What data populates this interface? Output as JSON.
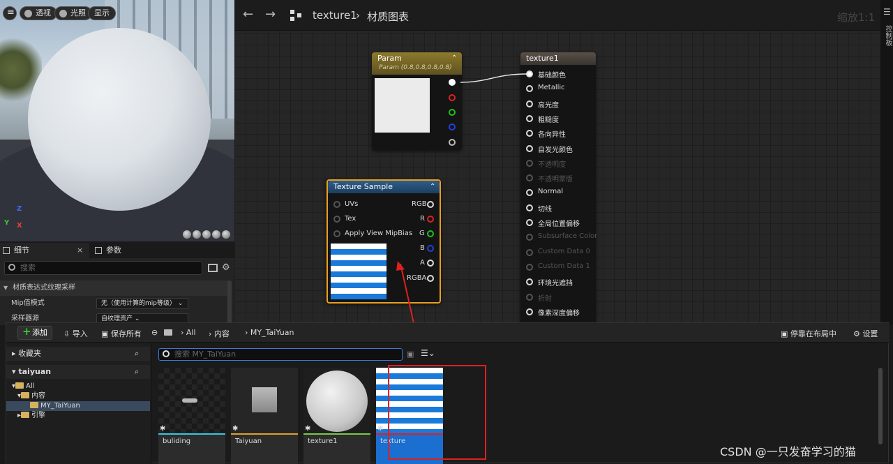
{
  "viewport": {
    "buttons": [
      "透视",
      "光照",
      "显示"
    ],
    "axes": {
      "z": "Z",
      "y": "Y",
      "x": "X"
    }
  },
  "details": {
    "tab_details": "细节",
    "tab_params": "参数",
    "search_placeholder": "搜索",
    "section": "材质表达式纹理采样",
    "rows": [
      {
        "label": "Mip值模式",
        "value": "无（使用计算的mip等级）"
      },
      {
        "label": "采样器源",
        "value": "自纹理资产"
      }
    ]
  },
  "graph": {
    "breadcrumb_asset": "texture1",
    "breadcrumb_sep": "›",
    "breadcrumb_graph": "材质图表",
    "zoom": "缩放1:1",
    "side_panel": "控制板",
    "param_node": {
      "title": "Param",
      "subtitle": "Param (0.8,0.8,0.8,0.8)"
    },
    "texture_node": {
      "title": "Texture Sample",
      "inputs": [
        "UVs",
        "Tex",
        "Apply View MipBias"
      ],
      "outputs": [
        "RGB",
        "R",
        "G",
        "B",
        "A",
        "RGBA"
      ]
    },
    "result_node": {
      "title": "texture1",
      "pins": [
        {
          "label": "基础颜色",
          "active": true,
          "connected": true
        },
        {
          "label": "Metallic",
          "active": true
        },
        {
          "label": "高光度",
          "active": true
        },
        {
          "label": "粗糙度",
          "active": true
        },
        {
          "label": "各向异性",
          "active": true
        },
        {
          "label": "自发光颜色",
          "active": true
        },
        {
          "label": "不透明度",
          "active": false
        },
        {
          "label": "不透明蒙版",
          "active": false
        },
        {
          "label": "Normal",
          "active": true
        },
        {
          "label": "切线",
          "active": true
        },
        {
          "label": "全局位置偏移",
          "active": true
        },
        {
          "label": "Subsurface Color",
          "active": false
        },
        {
          "label": "Custom Data 0",
          "active": false
        },
        {
          "label": "Custom Data 1",
          "active": false
        },
        {
          "label": "环境光遮挡",
          "active": true
        },
        {
          "label": "折射",
          "active": false
        },
        {
          "label": "像素深度偏移",
          "active": true
        }
      ]
    }
  },
  "content_browser": {
    "add": "添加",
    "import": "导入",
    "save_all": "保存所有",
    "path": [
      "All",
      "内容",
      "MY_TaiYuan"
    ],
    "dock": "停靠在布局中",
    "settings": "设置",
    "favorites": "收藏夹",
    "project": "taiyuan",
    "tree": [
      "All",
      "内容",
      "MY_TaiYuan",
      "引擎"
    ],
    "search_placeholder": "搜索 MY_TaiYuan",
    "assets": [
      {
        "name": "buliding",
        "color": "#38c6e0"
      },
      {
        "name": "Taiyuan",
        "color": "#e0a030"
      },
      {
        "name": "texture1",
        "color": "#7ac943"
      },
      {
        "name": "texture",
        "color": "#e02020"
      }
    ]
  },
  "watermark": "CSDN @一只发奋学习的猫"
}
